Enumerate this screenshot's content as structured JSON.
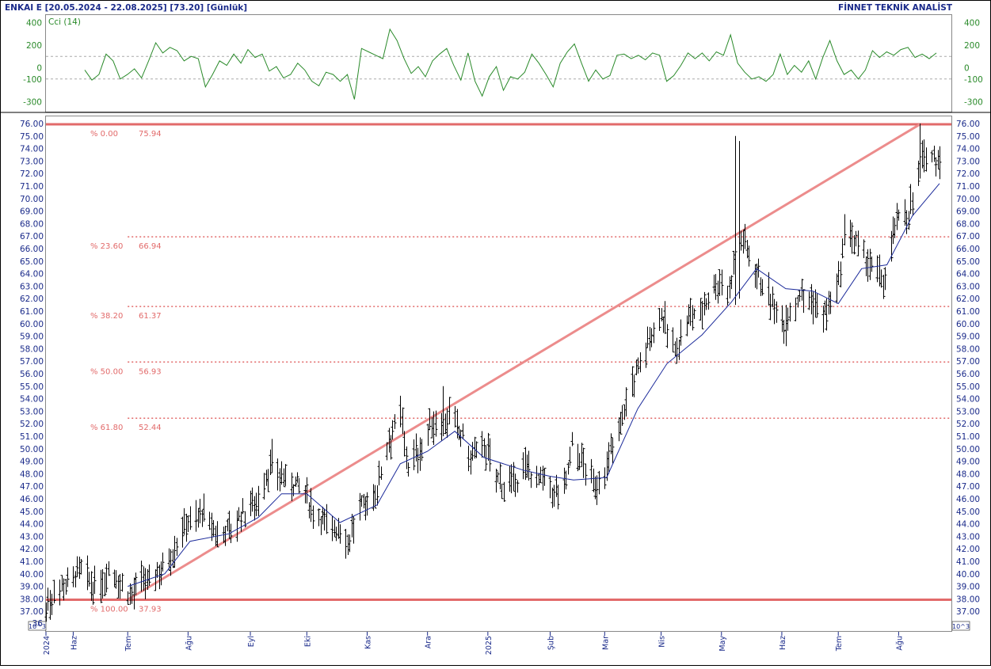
{
  "header": {
    "title": "ENKAI E  [20.05.2024 - 22.08.2025]  [73.20]  [Günlük]",
    "brand": "FİNNET TEKNİK ANALİST"
  },
  "scale_badge": "10^3",
  "colors": {
    "axis_text": "#1a2a8a",
    "cci_line": "#2a8a2a",
    "fib": "#e26a6a",
    "trend_line": "#ec8c8c",
    "moving_average": "#1b2a9a",
    "price_bars": "#000000"
  },
  "chart_data": [
    {
      "type": "line",
      "title": "Cci (14)",
      "ylim": [
        -370,
        420
      ],
      "y_ticks": [
        400,
        200,
        0,
        -100,
        -300
      ],
      "y_tick_labels": [
        "400",
        "200",
        "0",
        "-100",
        "-300"
      ],
      "reference_lines": [
        100,
        -100
      ],
      "series": [
        {
          "name": "Cci (14)",
          "color": "#2a8a2a",
          "values": [
            -20,
            -110,
            -60,
            120,
            60,
            -100,
            -60,
            -10,
            -90,
            60,
            220,
            130,
            180,
            150,
            60,
            100,
            80,
            -170,
            -60,
            60,
            20,
            120,
            40,
            160,
            90,
            120,
            -30,
            10,
            -90,
            -60,
            40,
            -20,
            -120,
            -160,
            -40,
            -60,
            -120,
            -60,
            -280,
            170,
            140,
            110,
            80,
            340,
            240,
            80,
            -50,
            10,
            -80,
            60,
            120,
            170,
            20,
            -110,
            130,
            -120,
            -250,
            -80,
            10,
            -200,
            -80,
            -100,
            -40,
            120,
            40,
            -60,
            -170,
            40,
            140,
            210,
            40,
            -120,
            -20,
            -100,
            -70,
            110,
            120,
            80,
            110,
            70,
            130,
            110,
            -120,
            -70,
            20,
            130,
            80,
            130,
            60,
            140,
            110,
            290,
            40,
            -40,
            -100,
            -80,
            -120,
            -60,
            120,
            -60,
            20,
            -40,
            60,
            -100,
            90,
            240,
            60,
            -60,
            -20,
            -100,
            -20,
            150,
            90,
            140,
            110,
            160,
            180,
            90,
            120,
            80,
            130
          ]
        }
      ]
    },
    {
      "type": "bar",
      "subtype": "ohlc",
      "ylim": [
        35.9,
        76.45
      ],
      "y_ticks": [
        37,
        38,
        39,
        40,
        41,
        42,
        43,
        44,
        45,
        46,
        47,
        48,
        49,
        50,
        51,
        52,
        53,
        54,
        55,
        56,
        57,
        58,
        59,
        60,
        61,
        62,
        63,
        64,
        65,
        66,
        67,
        68,
        69,
        70,
        71,
        72,
        73,
        74,
        75,
        76
      ],
      "y_tick_labels": [
        "37.00",
        "38.00",
        "39.00",
        "40.00",
        "41.00",
        "42.00",
        "43.00",
        "44.00",
        "45.00",
        "46.00",
        "47.00",
        "48.00",
        "49.00",
        "50.00",
        "51.00",
        "52.00",
        "53.00",
        "54.00",
        "55.00",
        "56.00",
        "57.00",
        "58.00",
        "59.00",
        "60.00",
        "61.00",
        "62.00",
        "63.00",
        "64.00",
        "65.00",
        "66.00",
        "67.00",
        "68.00",
        "69.00",
        "70.00",
        "71.00",
        "72.00",
        "73.00",
        "74.00",
        "75.00",
        "76.00"
      ],
      "y_tick_labels_left_partial_bottom": "36",
      "x_range": [
        "2024-05-20",
        "2025-08-22"
      ],
      "x_tick_labels": [
        {
          "label": "2024",
          "date": "2024-05-20"
        },
        {
          "label": "Haz",
          "date": "2024-06-03"
        },
        {
          "label": "Tem",
          "date": "2024-07-01"
        },
        {
          "label": "Ağu",
          "date": "2024-08-01"
        },
        {
          "label": "Eyl",
          "date": "2024-09-02"
        },
        {
          "label": "Eki",
          "date": "2024-10-01"
        },
        {
          "label": "Kas",
          "date": "2024-11-01"
        },
        {
          "label": "Ara",
          "date": "2024-12-02"
        },
        {
          "label": "2025",
          "date": "2025-01-02"
        },
        {
          "label": "Şub",
          "date": "2025-02-03"
        },
        {
          "label": "Mar",
          "date": "2025-03-03"
        },
        {
          "label": "Nis",
          "date": "2025-04-01"
        },
        {
          "label": "May",
          "date": "2025-05-02"
        },
        {
          "label": "Haz",
          "date": "2025-06-02"
        },
        {
          "label": "Tem",
          "date": "2025-07-01"
        },
        {
          "label": "Ağu",
          "date": "2025-08-01"
        }
      ],
      "fibonacci": [
        {
          "pct": "% 0.00",
          "value": 75.94
        },
        {
          "pct": "% 23.60",
          "value": 66.94
        },
        {
          "pct": "% 38.20",
          "value": 61.37
        },
        {
          "pct": "% 50.00",
          "value": 56.93
        },
        {
          "pct": "% 61.80",
          "value": 52.44
        },
        {
          "pct": "% 100.00",
          "value": 37.93
        }
      ],
      "fib_labels": [
        {
          "pct": "% 0.00",
          "value": "75.94"
        },
        {
          "pct": "% 23.60",
          "value": "66.94"
        },
        {
          "pct": "% 38.20",
          "value": "61.37"
        },
        {
          "pct": "% 50.00",
          "value": "56.93"
        },
        {
          "pct": "% 61.80",
          "value": "52.44"
        },
        {
          "pct": "% 100.00",
          "value": "37.93"
        }
      ],
      "trend_line": {
        "from": {
          "date": "2024-07-01",
          "price": 37.93
        },
        "to": {
          "date": "2025-08-12",
          "price": 75.94
        }
      },
      "moving_average": {
        "color": "#1b2a9a",
        "points": [
          [
            "2024-07-01",
            39.0
          ],
          [
            "2024-07-20",
            40.0
          ],
          [
            "2024-08-02",
            42.6
          ],
          [
            "2024-08-22",
            43.2
          ],
          [
            "2024-09-06",
            44.5
          ],
          [
            "2024-09-18",
            46.4
          ],
          [
            "2024-10-01",
            46.4
          ],
          [
            "2024-10-18",
            44.1
          ],
          [
            "2024-11-06",
            45.5
          ],
          [
            "2024-11-18",
            48.8
          ],
          [
            "2024-12-02",
            49.8
          ],
          [
            "2024-12-16",
            51.4
          ],
          [
            "2024-12-31",
            49.3
          ],
          [
            "2025-01-20",
            48.3
          ],
          [
            "2025-02-03",
            47.8
          ],
          [
            "2025-02-15",
            47.5
          ],
          [
            "2025-03-04",
            47.7
          ],
          [
            "2025-03-20",
            53.2
          ],
          [
            "2025-04-04",
            56.8
          ],
          [
            "2025-04-22",
            59.1
          ],
          [
            "2025-05-07",
            61.7
          ],
          [
            "2025-05-20",
            64.4
          ],
          [
            "2025-06-04",
            62.8
          ],
          [
            "2025-06-18",
            62.6
          ],
          [
            "2025-07-01",
            61.6
          ],
          [
            "2025-07-13",
            64.4
          ],
          [
            "2025-07-26",
            64.7
          ],
          [
            "2025-08-08",
            68.6
          ],
          [
            "2025-08-22",
            71.2
          ]
        ]
      },
      "price_path": [
        [
          "2024-05-20",
          37.2
        ],
        [
          "2024-05-25",
          38.8
        ],
        [
          "2024-05-31",
          39.4
        ],
        [
          "2024-06-07",
          40.2
        ],
        [
          "2024-06-14",
          38.7
        ],
        [
          "2024-06-21",
          40.3
        ],
        [
          "2024-06-28",
          39.1
        ],
        [
          "2024-07-02",
          38.3
        ],
        [
          "2024-07-09",
          39.2
        ],
        [
          "2024-07-16",
          40.1
        ],
        [
          "2024-07-24",
          41.8
        ],
        [
          "2024-07-31",
          44.2
        ],
        [
          "2024-08-08",
          44.8
        ],
        [
          "2024-08-15",
          43.1
        ],
        [
          "2024-08-22",
          43.6
        ],
        [
          "2024-08-30",
          44.9
        ],
        [
          "2024-09-06",
          46.2
        ],
        [
          "2024-09-13",
          48.8
        ],
        [
          "2024-09-19",
          47.6
        ],
        [
          "2024-09-26",
          47.1
        ],
        [
          "2024-10-03",
          45.3
        ],
        [
          "2024-10-10",
          44.1
        ],
        [
          "2024-10-17",
          43.5
        ],
        [
          "2024-10-22",
          42.6
        ],
        [
          "2024-10-29",
          45.2
        ],
        [
          "2024-11-05",
          46.2
        ],
        [
          "2024-11-11",
          50.4
        ],
        [
          "2024-11-18",
          52.6
        ],
        [
          "2024-11-22",
          48.6
        ],
        [
          "2024-11-29",
          50.2
        ],
        [
          "2024-12-06",
          52.3
        ],
        [
          "2024-12-12",
          52.6
        ],
        [
          "2024-12-18",
          51.3
        ],
        [
          "2024-12-24",
          49.2
        ],
        [
          "2024-12-31",
          50.3
        ],
        [
          "2025-01-08",
          47.2
        ],
        [
          "2025-01-15",
          46.9
        ],
        [
          "2025-01-22",
          48.6
        ],
        [
          "2025-01-29",
          47.3
        ],
        [
          "2025-02-05",
          46.2
        ],
        [
          "2025-02-11",
          47.3
        ],
        [
          "2025-02-14",
          50.5
        ],
        [
          "2025-02-20",
          48.8
        ],
        [
          "2025-02-26",
          46.8
        ],
        [
          "2025-03-04",
          48.6
        ],
        [
          "2025-03-11",
          52.2
        ],
        [
          "2025-03-18",
          55.6
        ],
        [
          "2025-03-25",
          58.5
        ],
        [
          "2025-04-01",
          60.7
        ],
        [
          "2025-04-08",
          57.6
        ],
        [
          "2025-04-15",
          60.6
        ],
        [
          "2025-04-22",
          61.2
        ],
        [
          "2025-04-29",
          63.3
        ],
        [
          "2025-05-06",
          62.6
        ],
        [
          "2025-05-10",
          67.3
        ],
        [
          "2025-05-14",
          66.4
        ],
        [
          "2025-05-20",
          64.3
        ],
        [
          "2025-05-28",
          61.4
        ],
        [
          "2025-06-04",
          60.3
        ],
        [
          "2025-06-11",
          62.4
        ],
        [
          "2025-06-18",
          61.6
        ],
        [
          "2025-06-25",
          60.8
        ],
        [
          "2025-07-01",
          63.2
        ],
        [
          "2025-07-05",
          68.2
        ],
        [
          "2025-07-10",
          66.2
        ],
        [
          "2025-07-17",
          64.6
        ],
        [
          "2025-07-24",
          63.4
        ],
        [
          "2025-07-31",
          68.2
        ],
        [
          "2025-08-06",
          68.9
        ],
        [
          "2025-08-12",
          72.5
        ],
        [
          "2025-08-16",
          73.6
        ],
        [
          "2025-08-22",
          73.2
        ]
      ]
    }
  ]
}
